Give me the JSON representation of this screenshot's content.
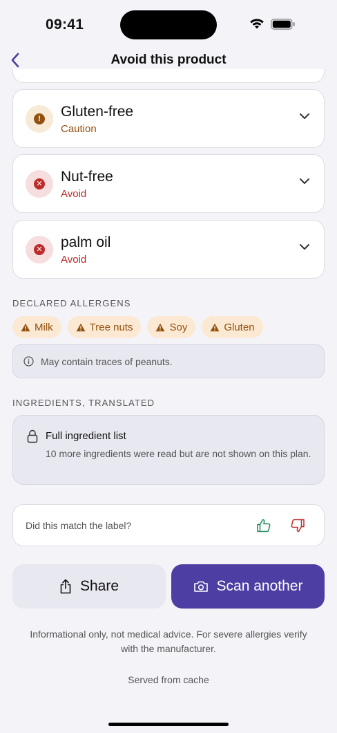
{
  "status_bar": {
    "time": "09:41"
  },
  "nav": {
    "title": "Avoid this product"
  },
  "dietary_checks": [
    {
      "title": "Gluten-free",
      "status": "Caution",
      "icon": "!"
    },
    {
      "title": "Nut-free",
      "status": "Avoid",
      "icon": "✕"
    },
    {
      "title": "palm oil",
      "status": "Avoid",
      "icon": "✕"
    }
  ],
  "allergens": {
    "label": "DECLARED ALLERGENS",
    "chips": [
      "Milk",
      "Tree nuts",
      "Soy",
      "Gluten"
    ],
    "notice": "May contain traces of peanuts."
  },
  "ingredients": {
    "label": "INGREDIENTS, TRANSLATED",
    "lock_title": "Full ingredient list",
    "lock_text": "10 more ingredients were read but are not shown on this plan."
  },
  "feedback": {
    "question": "Did this match the label?"
  },
  "actions": {
    "share_label": "Share",
    "scan_label": "Scan another"
  },
  "footer": {
    "disclaimer": "Informational only, not medical advice. For severe allergies verify with the manufacturer.",
    "cache_note": "Served from cache"
  },
  "colors": {
    "accent": "#4d3ea4",
    "caution": "#93510f",
    "avoid": "#bd2b2b",
    "thumbs_up": "#1c8a5a",
    "thumbs_down": "#bd2b2b"
  }
}
